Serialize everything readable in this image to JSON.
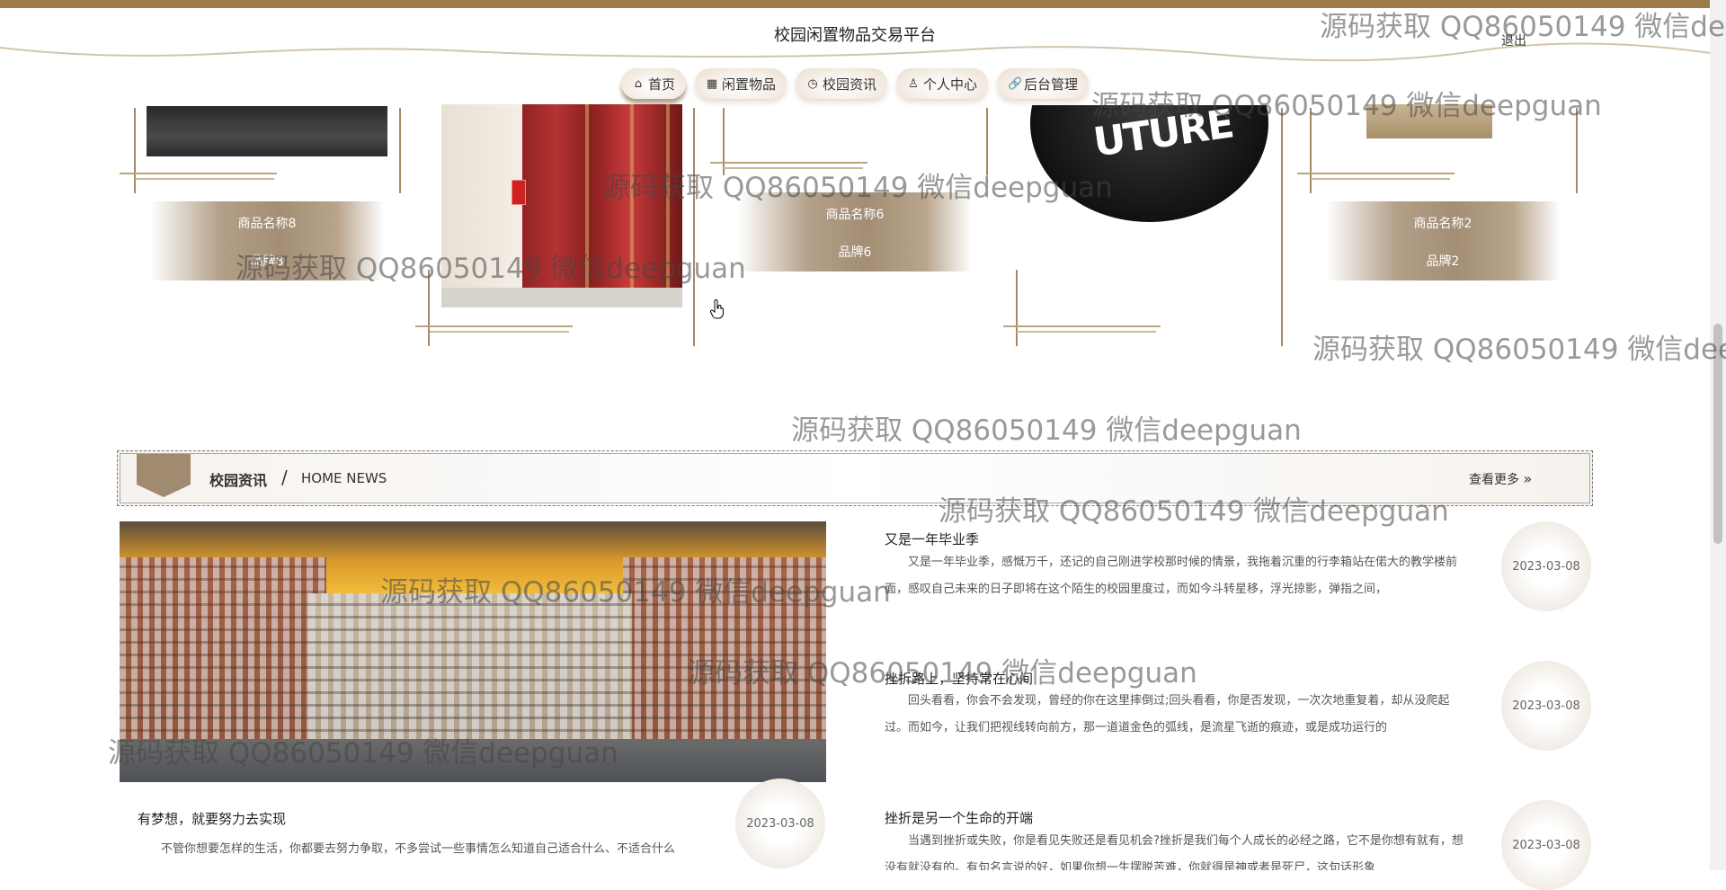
{
  "header": {
    "site_title": "校园闲置物品交易平台",
    "logout": "退出"
  },
  "nav": [
    {
      "label": "首页",
      "icon": "home-icon",
      "glyph": "⌂"
    },
    {
      "label": "闲置物品",
      "icon": "goods-icon",
      "glyph": "▦"
    },
    {
      "label": "校园资讯",
      "icon": "news-icon",
      "glyph": "◷"
    },
    {
      "label": "个人中心",
      "icon": "user-icon",
      "glyph": "♙"
    },
    {
      "label": "后台管理",
      "icon": "link-icon",
      "glyph": "🔗"
    }
  ],
  "products": [
    {
      "name": "商品名称8",
      "brand": "品牌8"
    },
    {
      "name": "商品名称6",
      "brand": "品牌6"
    },
    {
      "name": "商品名称2",
      "brand": "品牌2"
    }
  ],
  "news_section": {
    "title": "校园资讯",
    "separator": "/",
    "subtitle": "HOME NEWS",
    "more": "查看更多",
    "more_icon": "double-chevron-right-icon"
  },
  "news": [
    {
      "title": "有梦想，就要努力去实现",
      "date": "2023-03-08",
      "summary": "不管你想要怎样的生活，你都要去努力争取，不多尝试一些事情怎么知道自己适合什么、不适合什么"
    },
    {
      "title": "又是一年毕业季",
      "date": "2023-03-08",
      "summary": "又是一年毕业季，感慨万千，还记的自己刚进学校那时候的情景，我拖着沉重的行李箱站在偌大的教学楼前面，感叹自己未来的日子即将在这个陌生的校园里度过，而如今斗转星移，浮光掠影，弹指之间，"
    },
    {
      "title": "挫折路上，坚持常在心间",
      "date": "2023-03-08",
      "summary": "回头看看，你会不会发现，曾经的你在这里摔倒过;回头看看，你是否发现，一次次地重复着，却从没爬起过。而如今，让我们把视线转向前方，那一道道金色的弧线，是流星飞逝的痕迹，或是成功运行的"
    },
    {
      "title": "挫折是另一个生命的开端",
      "date": "2023-03-08",
      "summary": "当遇到挫折或失败，你是看见失败还是看见机会?挫折是我们每个人成长的必经之路，它不是你想有就有，想没有就没有的。有句名言说的好，如果你想一生摆脱苦难，你就得是神或者是死尸，这句话形象"
    }
  ],
  "watermark": "源码获取 QQ86050149 微信deepguan",
  "product_images": {
    "cap_text": "UTURE"
  }
}
